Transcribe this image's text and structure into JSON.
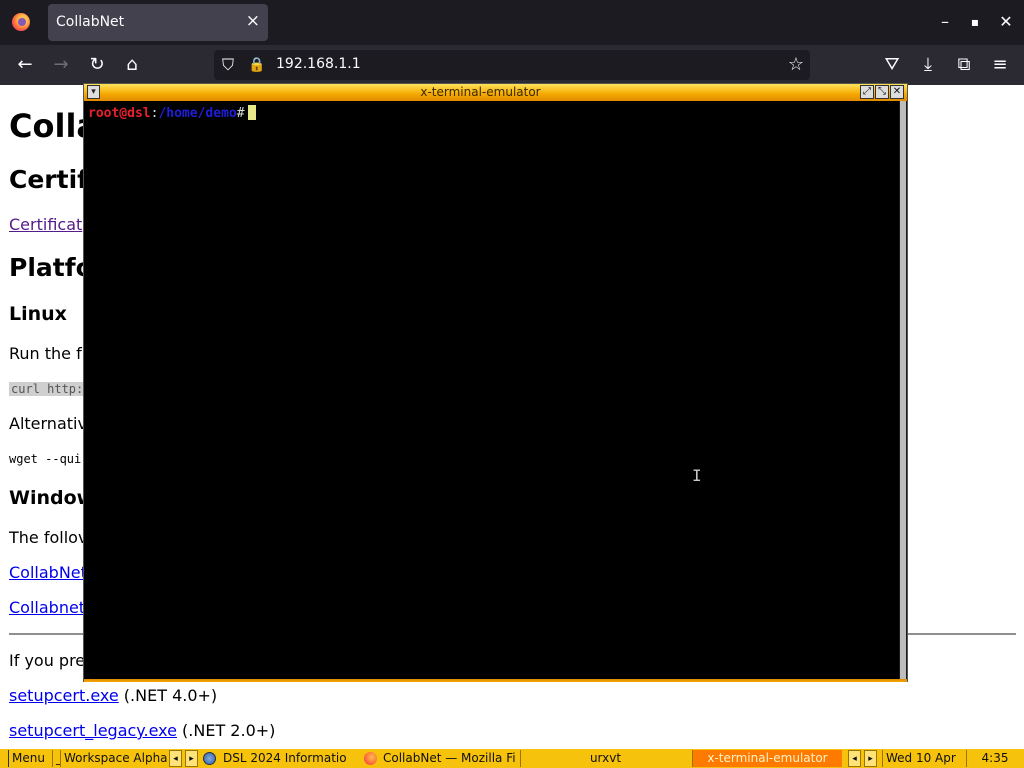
{
  "browser": {
    "tab_title": "CollabNet",
    "tab_close": "×",
    "url": "192.168.1.1",
    "window_controls": {
      "minimize": "–",
      "maximize": "▪",
      "close": "✕"
    },
    "nav_icons": {
      "back": "←",
      "forward": "→",
      "reload": "↻",
      "home": "⌂",
      "shield": "⛉",
      "lock": "🔒",
      "star": "☆",
      "pocket": "⛛",
      "download": "⤓",
      "extensions": "⧉",
      "menu": "≡"
    }
  },
  "page": {
    "h1": "Colla",
    "h2_cert": "Certif",
    "link_cert": "Certificat",
    "h2_platforms": "Platfo",
    "h3_linux": "Linux",
    "p_run": "Run the f",
    "code_curl": "curl http:",
    "p_alt": "Alternativ",
    "code_wget": "wget --qui",
    "h3_windows": "Window",
    "p_follow": "The follov",
    "link_collab1": "CollabNet",
    "link_collab2": "Collabnet",
    "p_prefer": "If you pre",
    "setup1_link": "setupcert.exe",
    "setup1_note": " (.NET 4.0+)",
    "setup2_link": "setupcert_legacy.exe",
    "setup2_note": " (.NET 2.0+)"
  },
  "terminal": {
    "title": "x-terminal-emulator",
    "prompt_user": "root@dsl",
    "prompt_colon": ":",
    "prompt_path": "/home/demo",
    "prompt_hash": "#",
    "buttons": {
      "iconify": "⤢",
      "maximize": "⤡",
      "close": "✕"
    },
    "menu_icon": "▾",
    "ibeam": "I"
  },
  "taskbar": {
    "menu": "Menu",
    "separator": "_",
    "workspace": "Workspace Alpha",
    "left_arrow": "◂",
    "right_arrow": "▸",
    "task_dsl": "DSL 2024 Informatio",
    "task_collabnet": "CollabNet — Mozilla Fi",
    "task_urxvt": "urxvt",
    "task_xterm": "x-terminal-emulator",
    "date": "Wed 10 Apr",
    "time": "4:35"
  },
  "colors": {
    "terminal_title_gradient": "#f5a800",
    "taskbar_bg": "#f6c20c",
    "active_task_bg": "#ff7a00",
    "prompt_user": "#e8202a",
    "prompt_path": "#1e1ed8"
  }
}
